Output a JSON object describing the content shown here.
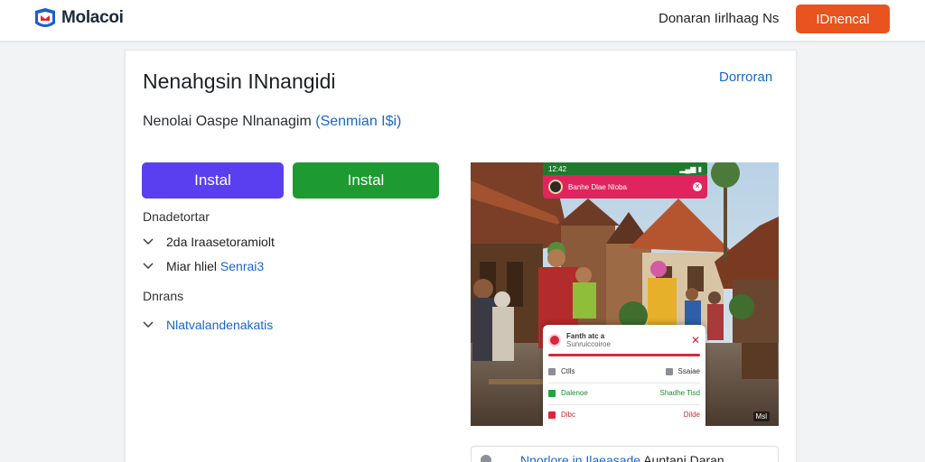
{
  "header": {
    "brand": "Molacoi",
    "nav_link": "Donaran Iirlhaag Ns",
    "cta_button": "IDnencal"
  },
  "card": {
    "title": "Nenahgsin INnangidi",
    "link": "Dorroran",
    "subtitle_main": "Nenolai Oaspe Nlnanagim",
    "subtitle_highlight": "(Senmian I$i)",
    "install_primary": "Instal",
    "install_secondary": "Instal",
    "section1_label": "Dnadetortar",
    "section1_items": [
      {
        "text": "2da Iraasetoramiolt",
        "highlight": ""
      },
      {
        "text": "Miar hliel",
        "highlight": "Senrai3"
      }
    ],
    "section2_label": "Dnrans",
    "section2_items": [
      {
        "text": "",
        "highlight": "Nlatvalandenakatis"
      }
    ]
  },
  "phone_overlay": {
    "status_time": "12:42",
    "notification": "Banhe Dlae Nloba",
    "dialog_title": "Fanth atc a",
    "dialog_sub": "Sunruiccoiroe",
    "dialog_row1_left": "Ctlls",
    "dialog_row1_right": "Ssaiae",
    "dialog_row2_left": "Dalenoe",
    "dialog_row2_right": "Shadhe Tisd",
    "dialog_row3_left": "Dibc",
    "dialog_row3_right": "Dilde",
    "watermark": "Msl"
  },
  "bottom_box": {
    "text_blue": "Nnorlore in Ilaeasade",
    "text_dark": "Auntani Daran"
  },
  "colors": {
    "cta": "#e8531f",
    "install_primary": "#5a3ff0",
    "install_secondary": "#1d9b31",
    "link": "#1a66c9"
  }
}
